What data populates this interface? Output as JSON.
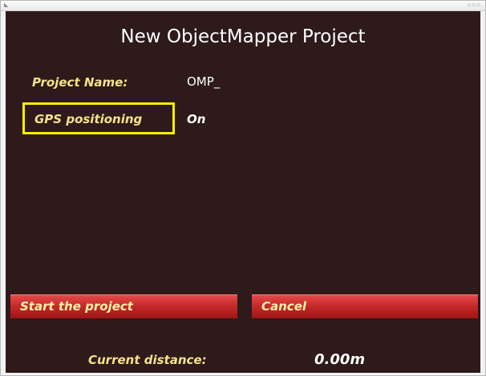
{
  "window": {
    "icon": "app-icon",
    "controls": "window-controls"
  },
  "header": {
    "title": "New ObjectMapper Project"
  },
  "form": {
    "project_name": {
      "label": "Project Name:",
      "value": "OMP_"
    },
    "gps": {
      "label": "GPS positioning",
      "value": "On",
      "selected": true,
      "highlight_color": "#ffee00"
    }
  },
  "actions": {
    "start_label": "Start the project",
    "cancel_label": "Cancel",
    "button_color": "#c62a2a"
  },
  "status": {
    "distance_label": "Current distance:",
    "distance_value": "0.00m"
  },
  "colors": {
    "background": "#2e1a1a",
    "label_text": "#f5e28a",
    "value_text": "#ffffff"
  }
}
